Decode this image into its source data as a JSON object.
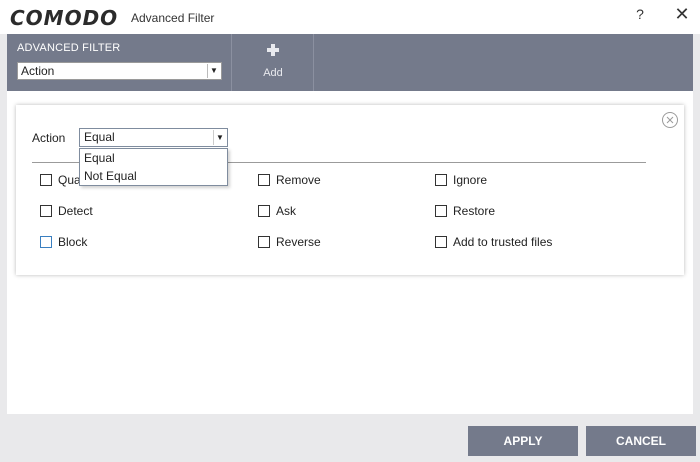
{
  "window": {
    "logo": "COMODO",
    "title": "Advanced Filter",
    "help_glyph": "?",
    "close_glyph": "✕"
  },
  "toolbar": {
    "section_label": "ADVANCED FILTER",
    "filter_select_value": "Action",
    "add_label": "Add"
  },
  "condition": {
    "label": "Action",
    "operator_value": "Equal",
    "operator_options": [
      "Equal",
      "Not Equal"
    ]
  },
  "checkboxes": [
    {
      "label": "Quarantine",
      "checked": false
    },
    {
      "label": "Remove",
      "checked": false
    },
    {
      "label": "Ignore",
      "checked": false
    },
    {
      "label": "Detect",
      "checked": false
    },
    {
      "label": "Ask",
      "checked": false
    },
    {
      "label": "Restore",
      "checked": false
    },
    {
      "label": "Block",
      "checked": false
    },
    {
      "label": "Reverse",
      "checked": false
    },
    {
      "label": "Add to trusted files",
      "checked": false
    }
  ],
  "footer": {
    "apply_label": "APPLY",
    "cancel_label": "CANCEL"
  },
  "colors": {
    "toolbar_bg": "#747a8b",
    "button_bg": "#747a8b"
  }
}
